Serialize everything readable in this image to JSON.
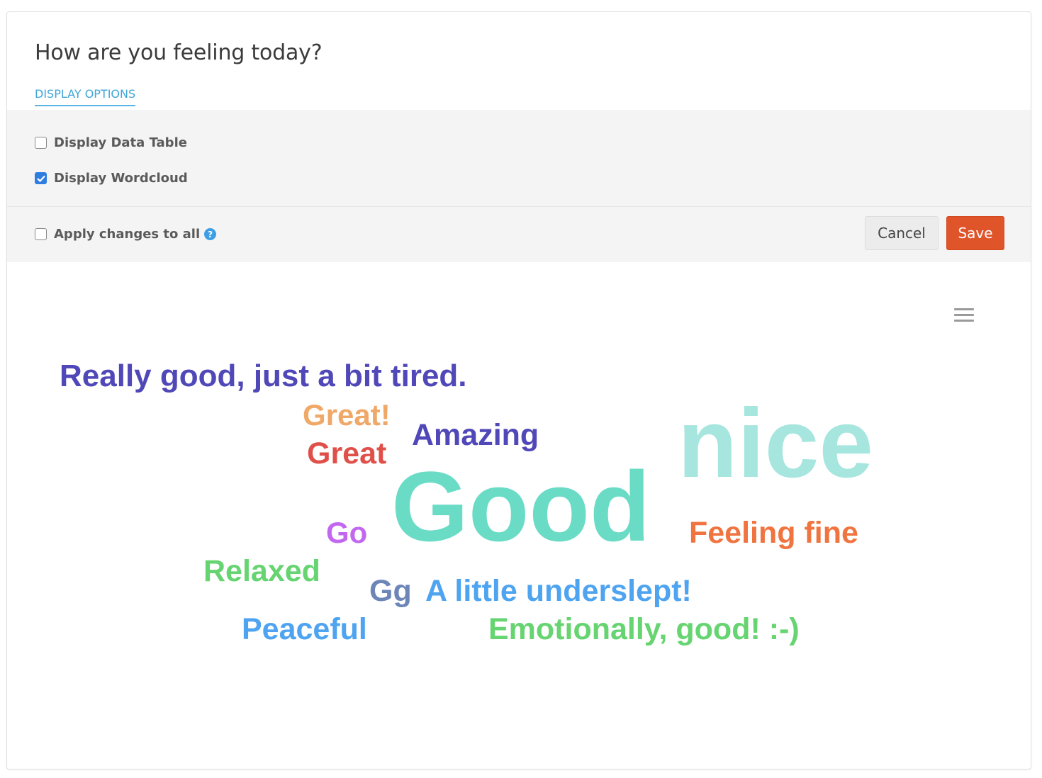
{
  "question": {
    "title": "How are you feeling today?"
  },
  "tabs": {
    "display_options": "DISPLAY OPTIONS"
  },
  "options": {
    "display_data_table": {
      "label": "Display Data Table",
      "checked": false
    },
    "display_wordcloud": {
      "label": "Display Wordcloud",
      "checked": true
    }
  },
  "actions": {
    "apply_changes_label": "Apply changes to all",
    "apply_changes_checked": false,
    "help_icon": "question-circle-icon",
    "cancel_label": "Cancel",
    "save_label": "Save"
  },
  "chart_menu": {
    "icon": "hamburger-menu-icon"
  },
  "wordcloud": {
    "words": [
      {
        "text": "Really good, just a bit tired.",
        "color": "#5048b8"
      },
      {
        "text": "Great!",
        "color": "#f0a868"
      },
      {
        "text": "Amazing",
        "color": "#5048b8"
      },
      {
        "text": "nice",
        "color": "#a6e6de"
      },
      {
        "text": "Great",
        "color": "#e0504a"
      },
      {
        "text": "Good",
        "color": "#6adcc6"
      },
      {
        "text": "Go",
        "color": "#c268f0"
      },
      {
        "text": "Feeling fine",
        "color": "#f07440"
      },
      {
        "text": "Relaxed",
        "color": "#66d470"
      },
      {
        "text": "Gg",
        "color": "#6c86b8"
      },
      {
        "text": "A little underslept!",
        "color": "#4ea4f0"
      },
      {
        "text": "Peaceful",
        "color": "#4ea4f0"
      },
      {
        "text": "Emotionally, good! :-)",
        "color": "#66d470"
      }
    ]
  }
}
